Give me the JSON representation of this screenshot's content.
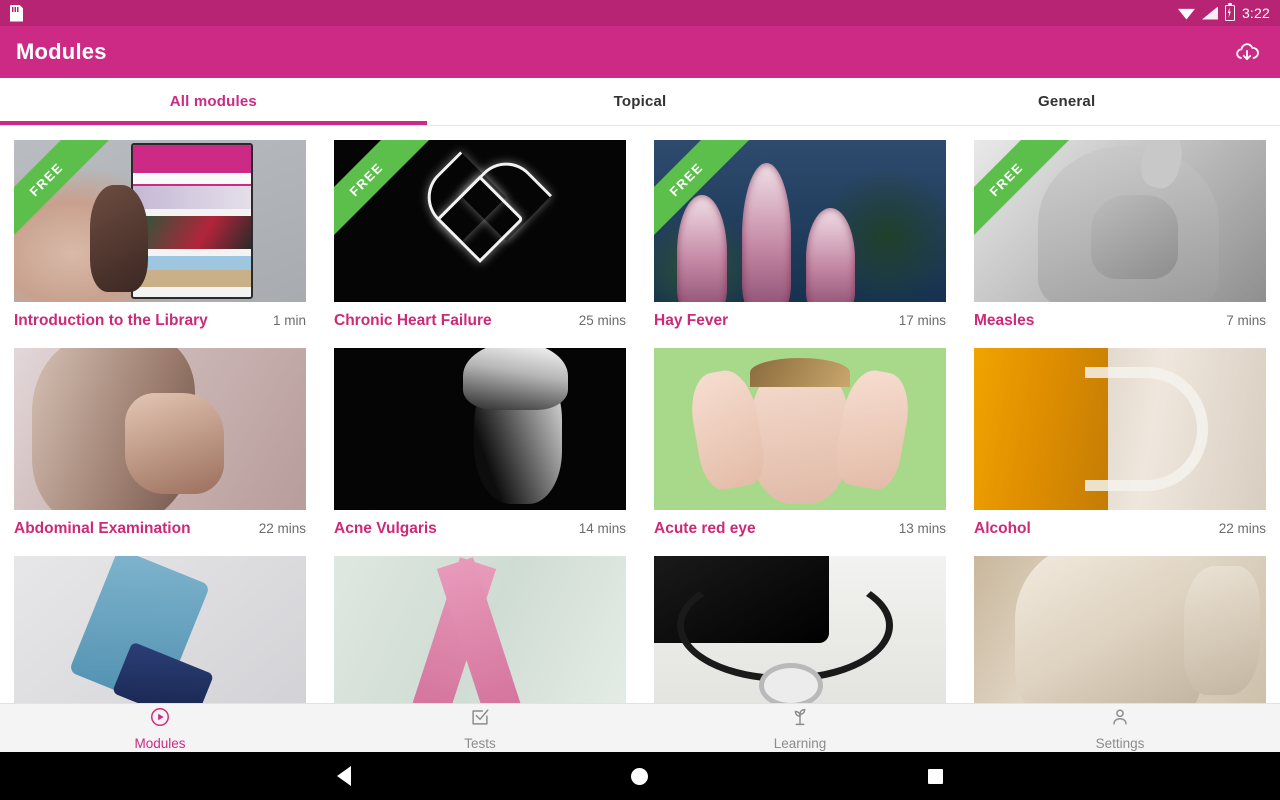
{
  "status_bar": {
    "time": "3:22",
    "icons": [
      "sd-card-icon",
      "wifi-icon",
      "signal-icon",
      "battery-charging-icon"
    ]
  },
  "app_bar": {
    "title": "Modules",
    "action_icon": "cloud-download-icon",
    "background_color": "#cc2a85"
  },
  "tabs": {
    "items": [
      {
        "label": "All modules",
        "active": true
      },
      {
        "label": "Topical",
        "active": false
      },
      {
        "label": "General",
        "active": false
      }
    ],
    "active_color": "#cc2a85"
  },
  "modules": {
    "free_badge_label": "FREE",
    "free_badge_color": "#5cbf4b",
    "title_color": "#cc2a77",
    "items": [
      {
        "title": "Introduction to the Library",
        "duration": "1 min",
        "free": true,
        "art": "art-library"
      },
      {
        "title": "Chronic Heart Failure",
        "duration": "25 mins",
        "free": true,
        "art": "art-heart"
      },
      {
        "title": "Hay Fever",
        "duration": "17 mins",
        "free": true,
        "art": "art-foxglove"
      },
      {
        "title": "Measles",
        "duration": "7 mins",
        "free": true,
        "art": "art-measles"
      },
      {
        "title": "Abdominal Examination",
        "duration": "22 mins",
        "free": false,
        "art": "art-abdomen"
      },
      {
        "title": "Acne Vulgaris",
        "duration": "14 mins",
        "free": false,
        "art": "art-acne"
      },
      {
        "title": "Acute red eye",
        "duration": "13 mins",
        "free": false,
        "art": "art-eye"
      },
      {
        "title": "Alcohol",
        "duration": "22 mins",
        "free": false,
        "art": "art-beer"
      },
      {
        "title": "",
        "duration": "",
        "free": false,
        "art": "art-inhaler"
      },
      {
        "title": "",
        "duration": "",
        "free": false,
        "art": "art-ribbon2"
      },
      {
        "title": "",
        "duration": "",
        "free": false,
        "art": "art-steth"
      },
      {
        "title": "",
        "duration": "",
        "free": false,
        "art": "art-marble"
      }
    ]
  },
  "bottom_nav": {
    "items": [
      {
        "label": "Modules",
        "icon": "play-circle-icon",
        "active": true
      },
      {
        "label": "Tests",
        "icon": "checkbox-icon",
        "active": false
      },
      {
        "label": "Learning",
        "icon": "sprout-icon",
        "active": false
      },
      {
        "label": "Settings",
        "icon": "person-icon",
        "active": false
      }
    ],
    "active_color": "#cc2a85",
    "inactive_color": "#8c8c8c"
  },
  "system_nav": {
    "buttons": [
      "back-button",
      "home-button",
      "recents-button"
    ]
  }
}
